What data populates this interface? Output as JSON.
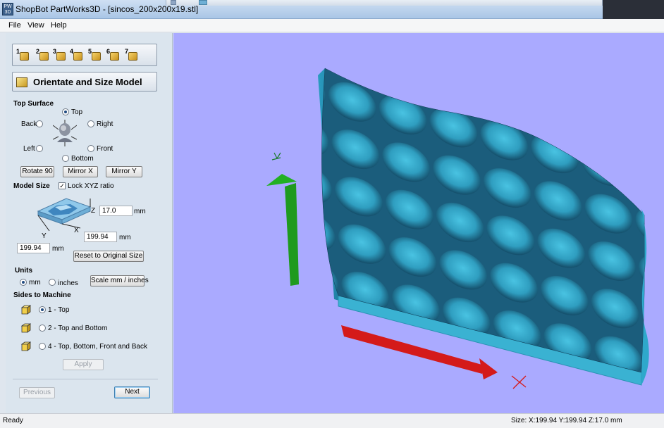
{
  "window": {
    "title": "ShopBot PartWorks3D - [sincos_200x200x19.stl]",
    "app_icon_text": "PW 3D"
  },
  "menu": [
    "File",
    "View",
    "Help"
  ],
  "toolbar": {
    "steps": [
      "1",
      "2",
      "3",
      "4",
      "5",
      "6",
      "7"
    ]
  },
  "panel": {
    "heading": "Orientate and Size Model",
    "top_surface": {
      "title": "Top Surface",
      "options": {
        "top": "Top",
        "back": "Back",
        "right": "Right",
        "left": "Left",
        "front": "Front",
        "bottom": "Bottom"
      },
      "selected": "Top",
      "buttons": {
        "rotate": "Rotate 90",
        "mirror_x": "Mirror X",
        "mirror_y": "Mirror Y"
      }
    },
    "model_size": {
      "title": "Model Size",
      "lock_label": "Lock XYZ ratio",
      "lock_checked": true,
      "z_value": "17.0",
      "x_value": "199.94",
      "y_value": "199.94",
      "unit": "mm",
      "axis_z": "Z",
      "axis_x": "X",
      "axis_y": "Y",
      "reset_label": "Reset to Original Size"
    },
    "units": {
      "title": "Units",
      "mm": "mm",
      "inches": "inches",
      "selected": "mm",
      "scale_label": "Scale mm / inches"
    },
    "sides": {
      "title": "Sides to Machine",
      "options": [
        "1 - Top",
        "2 - Top and Bottom",
        "4 - Top, Bottom, Front and Back"
      ],
      "selected": 0,
      "apply_label": "Apply"
    },
    "nav": {
      "previous": "Previous",
      "next": "Next"
    }
  },
  "status": {
    "left": "Ready",
    "right": "Size: X:199.94 Y:199.94 Z:17.0 mm"
  },
  "colors": {
    "viewport_bg": "#aaaaff",
    "model": "#3cb4d4",
    "y_axis": "#1f9a1f",
    "x_axis": "#d41a1a"
  }
}
